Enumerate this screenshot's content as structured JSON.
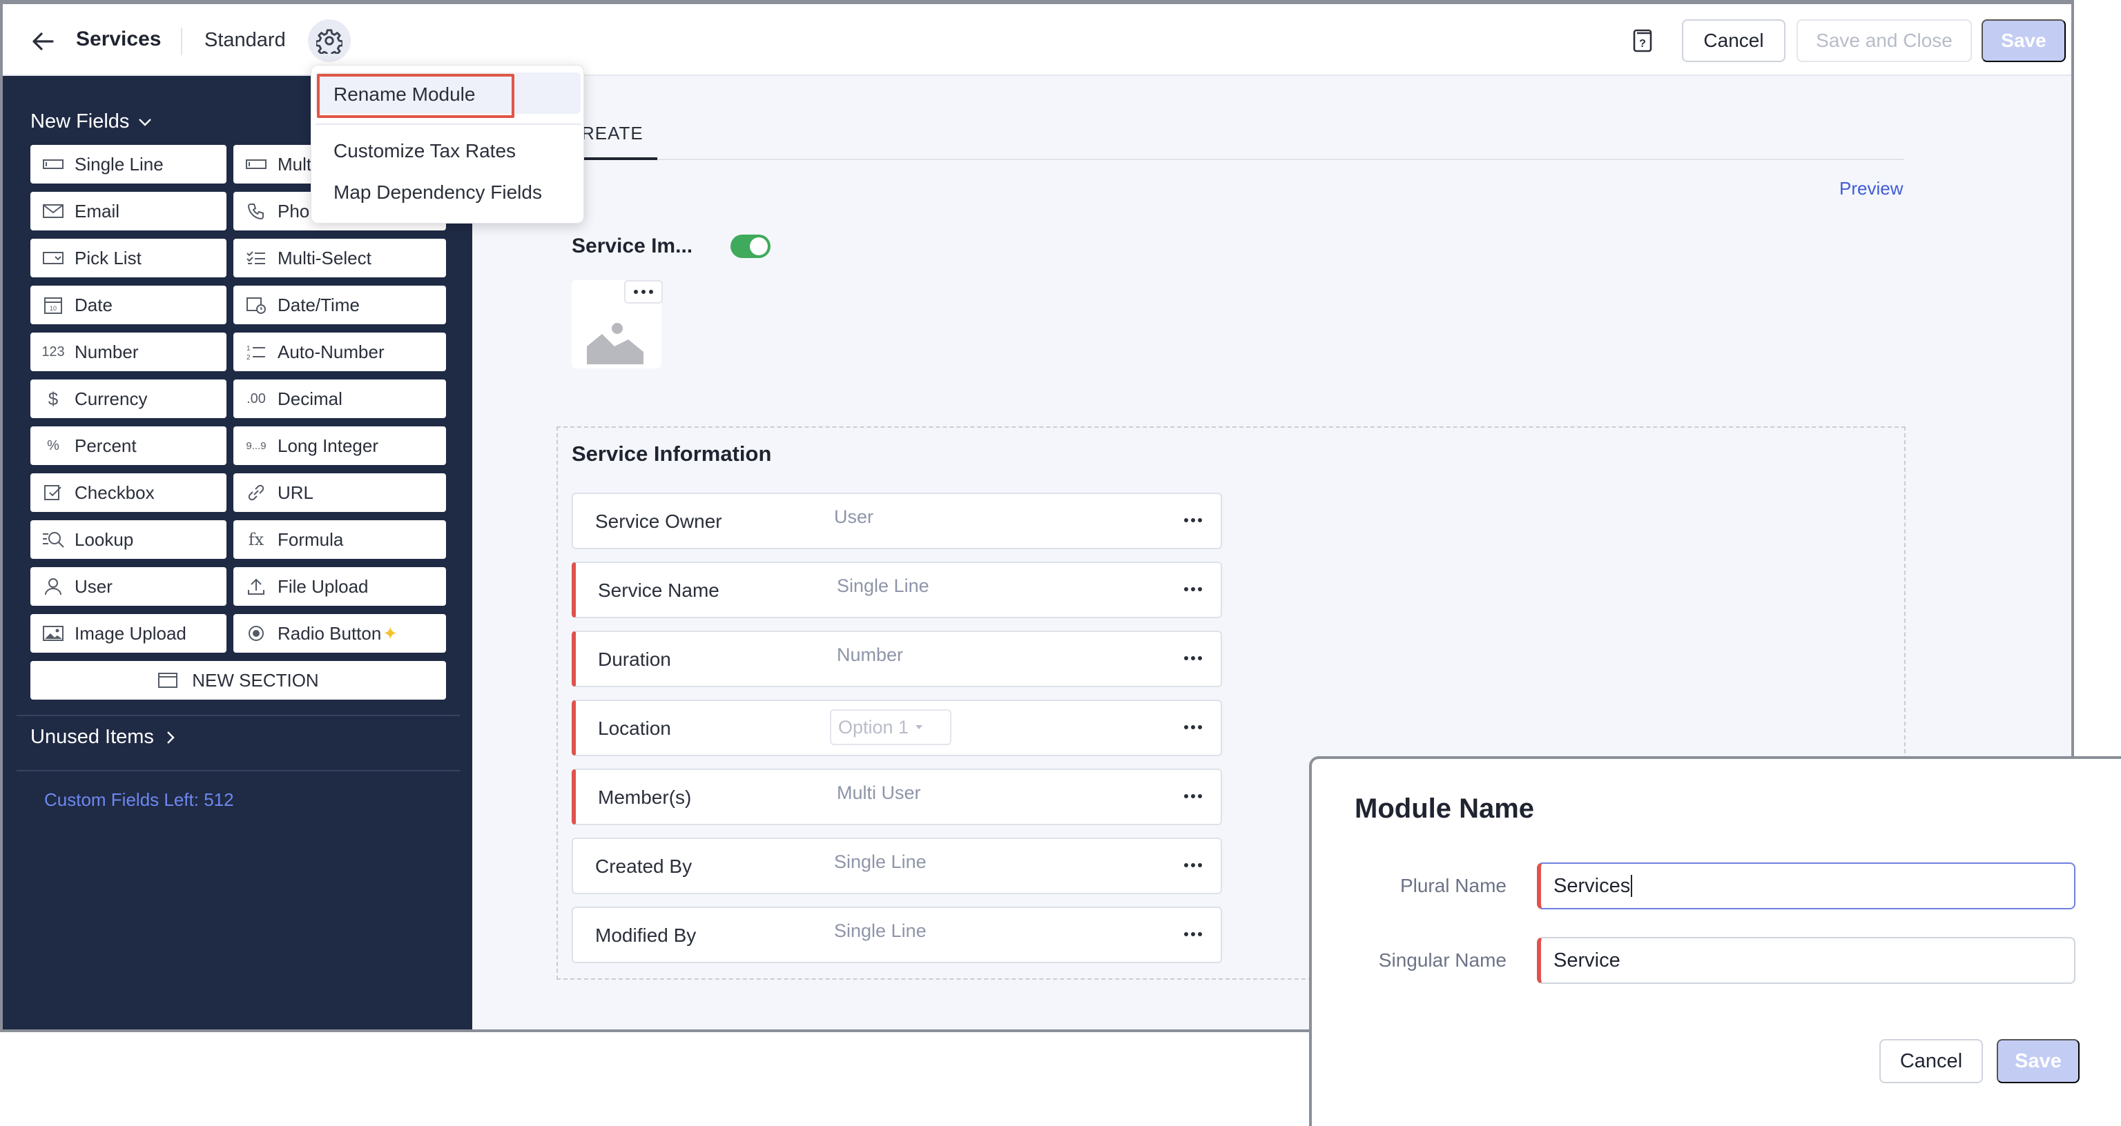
{
  "header": {
    "title": "Services",
    "layout": "Standard",
    "cancel_label": "Cancel",
    "save_close_label": "Save and Close",
    "save_label": "Save"
  },
  "menu": {
    "items": [
      "Rename Module",
      "Customize Tax Rates",
      "Map Dependency Fields"
    ]
  },
  "sidebar": {
    "new_fields_label": "New Fields",
    "fields": [
      {
        "label": "Single Line",
        "icon": "single-line-icon"
      },
      {
        "label": "Multi Line",
        "icon": "multi-line-icon"
      },
      {
        "label": "Email",
        "icon": "email-icon"
      },
      {
        "label": "Phone",
        "icon": "phone-icon"
      },
      {
        "label": "Pick List",
        "icon": "picklist-icon"
      },
      {
        "label": "Multi-Select",
        "icon": "multi-select-icon"
      },
      {
        "label": "Date",
        "icon": "date-icon"
      },
      {
        "label": "Date/Time",
        "icon": "date-time-icon"
      },
      {
        "label": "Number",
        "icon": "number-icon"
      },
      {
        "label": "Auto-Number",
        "icon": "auto-number-icon"
      },
      {
        "label": "Currency",
        "icon": "currency-icon"
      },
      {
        "label": "Decimal",
        "icon": "decimal-icon"
      },
      {
        "label": "Percent",
        "icon": "percent-icon"
      },
      {
        "label": "Long Integer",
        "icon": "long-integer-icon"
      },
      {
        "label": "Checkbox",
        "icon": "checkbox-icon"
      },
      {
        "label": "URL",
        "icon": "url-icon"
      },
      {
        "label": "Lookup",
        "icon": "lookup-icon"
      },
      {
        "label": "Formula",
        "icon": "formula-icon"
      },
      {
        "label": "User",
        "icon": "user-icon"
      },
      {
        "label": "File Upload",
        "icon": "file-upload-icon"
      },
      {
        "label": "Image Upload",
        "icon": "image-upload-icon"
      },
      {
        "label": "Radio Button",
        "icon": "radio-button-icon"
      }
    ],
    "new_section_label": "NEW SECTION",
    "unused_items_label": "Unused Items",
    "custom_fields_left": "Custom Fields Left: 512"
  },
  "canvas": {
    "tab_label": "REATE",
    "preview_label": "Preview",
    "image_field_label": "Service Im...",
    "section_title": "Service Information",
    "fields": [
      {
        "label": "Service Owner",
        "type": "User",
        "required": false
      },
      {
        "label": "Service Name",
        "type": "Single Line",
        "required": true
      },
      {
        "label": "Duration",
        "type": "Number",
        "required": true
      },
      {
        "label": "Location",
        "type": "Option 1",
        "required": true
      },
      {
        "label": "Member(s)",
        "type": "Multi User",
        "required": true
      },
      {
        "label": "Created By",
        "type": "Single Line",
        "required": false
      },
      {
        "label": "Modified By",
        "type": "Single Line",
        "required": false
      }
    ]
  },
  "dialog": {
    "title": "Module Name",
    "plural_label": "Plural Name",
    "plural_value": "Services",
    "singular_label": "Singular Name",
    "singular_value": "Service",
    "cancel_label": "Cancel",
    "save_label": "Save"
  },
  "colors": {
    "sidebar_bg": "#1f2a44",
    "accent_blue": "#3f5bd9",
    "required_red": "#e0524d",
    "toggle_green": "#3faa5c",
    "disabled_save": "#c3ccf3"
  }
}
